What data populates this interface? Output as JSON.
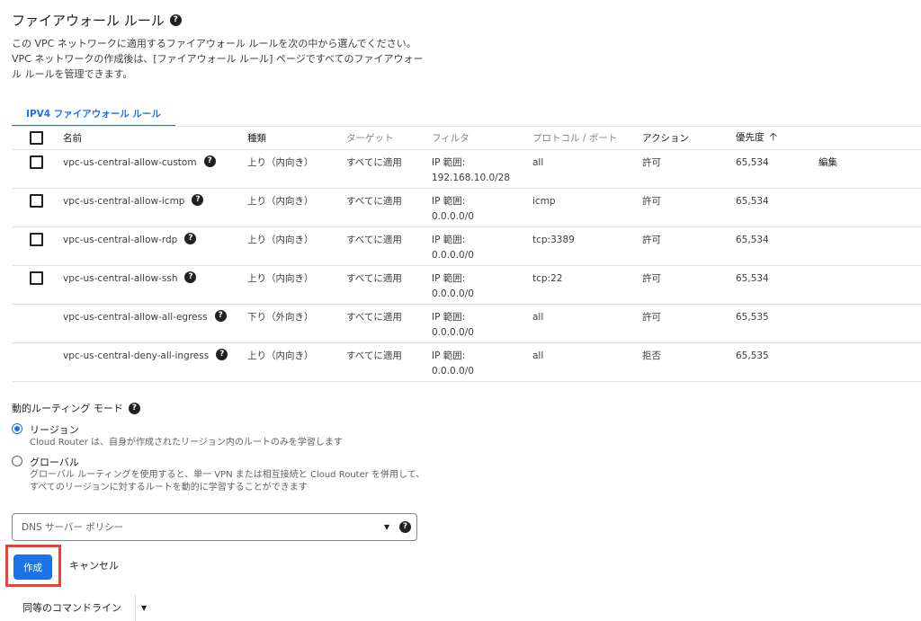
{
  "header": {
    "title": "ファイアウォール ルール",
    "description": "この VPC ネットワークに適用するファイアウォール ルールを次の中から選んでください。VPC ネットワークの作成後は、[ファイアウォール ルール] ページですべてのファイアウォール ルールを管理できます。"
  },
  "tabs": [
    {
      "label": "IPV4 ファイアウォール ルール",
      "active": true
    }
  ],
  "table": {
    "columns": [
      "名前",
      "種類",
      "ターゲット",
      "フィルタ",
      "プロトコル / ポート",
      "アクション",
      "優先度"
    ],
    "sort_column": "優先度",
    "sort_direction": "ascending",
    "rows": [
      {
        "name": "vpc-us-central-allow-custom",
        "type": "上り（内向き）",
        "target": "すべてに適用",
        "filter_label": "IP 範囲:",
        "filter_value": "192.168.10.0/28",
        "protocol": "all",
        "action": "許可",
        "priority": "65,534",
        "edit": "編集",
        "checkbox": true
      },
      {
        "name": "vpc-us-central-allow-icmp",
        "type": "上り（内向き）",
        "target": "すべてに適用",
        "filter_label": "IP 範囲:",
        "filter_value": "0.0.0.0/0",
        "protocol": "icmp",
        "action": "許可",
        "priority": "65,534",
        "edit": "",
        "checkbox": true
      },
      {
        "name": "vpc-us-central-allow-rdp",
        "type": "上り（内向き）",
        "target": "すべてに適用",
        "filter_label": "IP 範囲:",
        "filter_value": "0.0.0.0/0",
        "protocol": "tcp:3389",
        "action": "許可",
        "priority": "65,534",
        "edit": "",
        "checkbox": true
      },
      {
        "name": "vpc-us-central-allow-ssh",
        "type": "上り（内向き）",
        "target": "すべてに適用",
        "filter_label": "IP 範囲:",
        "filter_value": "0.0.0.0/0",
        "protocol": "tcp:22",
        "action": "許可",
        "priority": "65,534",
        "edit": "",
        "checkbox": true
      },
      {
        "name": "vpc-us-central-allow-all-egress",
        "type": "下り（外向き）",
        "target": "すべてに適用",
        "filter_label": "IP 範囲:",
        "filter_value": "0.0.0.0/0",
        "protocol": "all",
        "action": "許可",
        "priority": "65,535",
        "edit": "",
        "checkbox": false
      },
      {
        "name": "vpc-us-central-deny-all-ingress",
        "type": "上り（内向き）",
        "target": "すべてに適用",
        "filter_label": "IP 範囲:",
        "filter_value": "0.0.0.0/0",
        "protocol": "all",
        "action": "拒否",
        "priority": "65,535",
        "edit": "",
        "checkbox": false
      }
    ]
  },
  "routing": {
    "title": "動的ルーティング モード",
    "options": [
      {
        "label": "リージョン",
        "hint": "Cloud Router は、自身が作成されたリージョン内のルートのみを学習します",
        "selected": true
      },
      {
        "label": "グローバル",
        "hint": "グローバル ルーティングを使用すると、単一 VPN または相互接続と Cloud Router を併用して、すべてのリージョンに対するルートを動的に学習することができます",
        "selected": false
      }
    ]
  },
  "dns": {
    "placeholder": "DNS サーバー ポリシー"
  },
  "actions": {
    "create": "作成",
    "cancel": "キャンセル",
    "command_line": "同等のコマンドライン"
  },
  "colors": {
    "accent": "#1a73e8",
    "highlight_box": "#ea4335"
  }
}
